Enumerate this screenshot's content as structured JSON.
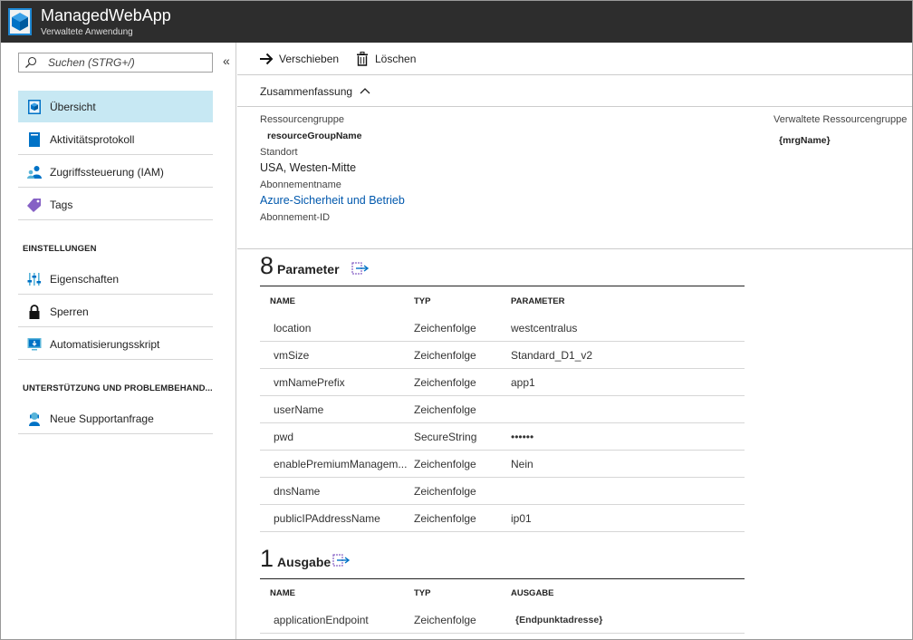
{
  "header": {
    "title": "ManagedWebApp",
    "subtitle": "Verwaltete Anwendung",
    "icon": "managed-app-cube-icon"
  },
  "sidebar": {
    "search_placeholder": "Suchen (STRG+/)",
    "collapse_symbol": "«",
    "items": [
      {
        "label": "Übersicht",
        "icon": "overview-icon"
      },
      {
        "label": "Aktivitätsprotokoll",
        "icon": "activity-log-icon"
      },
      {
        "label": "Zugriffssteuerung (IAM)",
        "icon": "iam-icon"
      },
      {
        "label": "Tags",
        "icon": "tag-icon"
      }
    ],
    "settings_label": "EINSTELLUNGEN",
    "settings_items": [
      {
        "label": "Eigenschaften",
        "icon": "properties-icon"
      },
      {
        "label": "Sperren",
        "icon": "lock-icon"
      },
      {
        "label": "Automatisierungsskript",
        "icon": "automation-script-icon"
      }
    ],
    "support_label": "UNTERSTÜTZUNG UND PROBLEMBEHAND...",
    "support_items": [
      {
        "label": "Neue Supportanfrage",
        "icon": "support-icon"
      }
    ]
  },
  "toolbar": {
    "move_label": "Verschieben",
    "delete_label": "Löschen"
  },
  "summary": {
    "label": "Zusammenfassung",
    "resource_group_label": "Ressourcengruppe",
    "resource_group_value": "resourceGroupName",
    "location_label": "Standort",
    "location_value": "USA, Westen-Mitte",
    "subscription_name_label": "Abonnementname",
    "subscription_name_value": "Azure-Sicherheit und Betrieb",
    "subscription_id_label": "Abonnement-ID",
    "managed_rg_label": "Verwaltete Ressourcengruppe",
    "managed_rg_value": "{mrgName}"
  },
  "parameters": {
    "count": "8",
    "title": "Parameter",
    "headers": {
      "name": "NAME",
      "type": "TYP",
      "value": "PARAMETER"
    },
    "rows": [
      {
        "name": "location",
        "type": "Zeichenfolge",
        "value": "westcentralus"
      },
      {
        "name": "vmSize",
        "type": "Zeichenfolge",
        "value": "Standard_D1_v2"
      },
      {
        "name": "vmNamePrefix",
        "type": "Zeichenfolge",
        "value": "app1"
      },
      {
        "name": "userName",
        "type": "Zeichenfolge",
        "value": ""
      },
      {
        "name": "pwd",
        "type": "SecureString",
        "value": "••••••"
      },
      {
        "name": "enablePremiumManagem...",
        "type": "Zeichenfolge",
        "value": "Nein"
      },
      {
        "name": "dnsName",
        "type": "Zeichenfolge",
        "value": ""
      },
      {
        "name": "publicIPAddressName",
        "type": "Zeichenfolge",
        "value": "ip01"
      }
    ]
  },
  "outputs": {
    "count": "1",
    "title": "Ausgabe",
    "headers": {
      "name": "NAME",
      "type": "TYP",
      "value": "AUSGABE"
    },
    "rows": [
      {
        "name": "applicationEndpoint",
        "type": "Zeichenfolge",
        "value": "{Endpunktadresse}"
      }
    ]
  },
  "colors": {
    "header_bg": "#2d2d2d",
    "active_nav_bg": "#c7e8f3",
    "link": "#0058ad",
    "azure_blue": "#0072c6"
  }
}
